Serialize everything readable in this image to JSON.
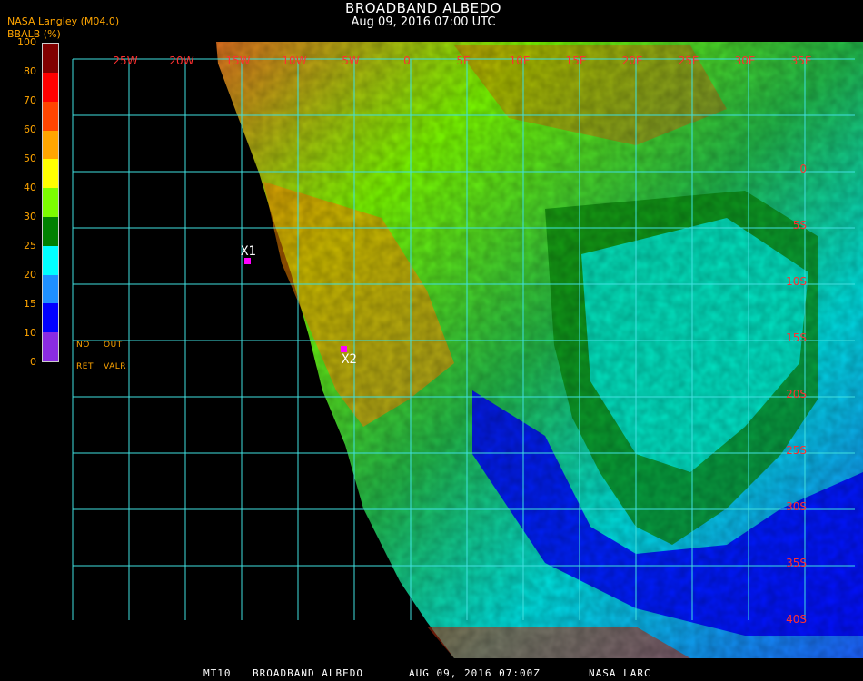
{
  "title": "BROADBAND ALBEDO",
  "subtitle": "Aug 09, 2016 07:00 UTC",
  "organization": "NASA Langley (M04.0)",
  "colorbar": {
    "label": "BBALB (%)",
    "ticks": [
      "100",
      "80",
      "70",
      "60",
      "50",
      "40",
      "30",
      "25",
      "20",
      "15",
      "10",
      "0"
    ],
    "colors": [
      "#8a2be2",
      "#0000ff",
      "#1e90ff",
      "#00ffff",
      "#008000",
      "#7cfc00",
      "#ffff00",
      "#ffa500",
      "#ff4500",
      "#ff0000",
      "#800000"
    ],
    "no_retrieval_label_top": "NO",
    "no_retrieval_label_bottom": "RET",
    "out_of_range_label_top": "OUT",
    "out_of_range_label_bottom": "VALR"
  },
  "map": {
    "longitude_labels": [
      "25W",
      "20W",
      "15W",
      "10W",
      "5W",
      "0",
      "5E",
      "10E",
      "15E",
      "20E",
      "25E",
      "30E",
      "35E"
    ],
    "latitude_labels": [
      "0",
      "5S",
      "10S",
      "15S",
      "20S",
      "25S",
      "30S",
      "35S",
      "40S"
    ],
    "markers": [
      {
        "label": "X1"
      },
      {
        "label": "X2"
      }
    ]
  },
  "footer": {
    "satellite": "MT10",
    "product": "BROADBAND ALBEDO",
    "datetime": "AUG 09, 2016 07:00Z",
    "source": "NASA LARC"
  }
}
